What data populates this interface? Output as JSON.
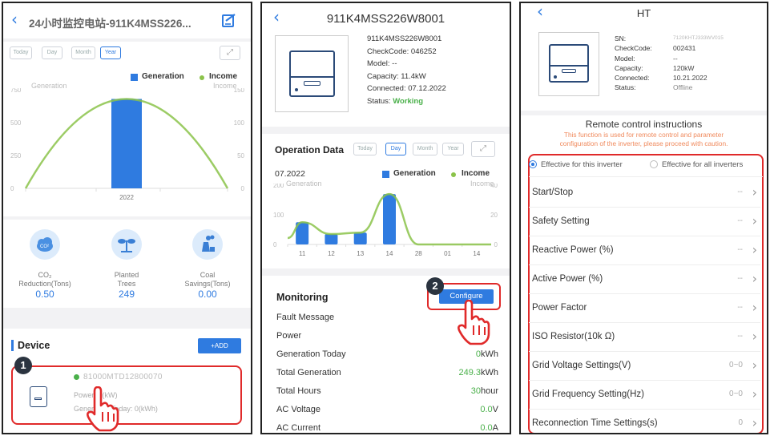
{
  "phone1": {
    "title": "24小时监控电站-911K4MSS226...",
    "tabs": [
      "Today",
      "Day",
      "Month",
      "Year"
    ],
    "legend_generation": "Generation",
    "legend_income": "Income",
    "axis_left_title": "Generation",
    "axis_right_title": "Income",
    "left_ticks": [
      "750",
      "500",
      "250",
      "0"
    ],
    "right_ticks": [
      "150",
      "100",
      "50",
      "0"
    ],
    "x_label": "2022",
    "stats": [
      {
        "label1": "CO₂",
        "label2": "Reduction(Tons)",
        "value": "0.50"
      },
      {
        "label1": "Planted",
        "label2": "Trees",
        "value": "249"
      },
      {
        "label1": "Coal",
        "label2": "Savings(Tons)",
        "value": "0.00"
      }
    ],
    "device_header": "Device",
    "add_label": "+ADD",
    "device_sn": "81000MTD12800070",
    "device_power": "Power: 0(kW)",
    "device_gen_today": "Generation Today: 0(kWh)",
    "badge": "1"
  },
  "phone2": {
    "title": "911K4MSS226W8001",
    "info": {
      "sn": "911K4MSS226W8001",
      "checkcode": "CheckCode: 046252",
      "model": "Model: --",
      "capacity": "Capacity: 11.4kW",
      "connected": "Connected: 07.12.2022",
      "status_label": "Status: ",
      "status_value": "Working"
    },
    "operation_title": "Operation Data",
    "tabs": [
      "Today",
      "Day",
      "Month",
      "Year"
    ],
    "date": "07.2022",
    "legend_generation": "Generation",
    "legend_income": "Income",
    "axis_left_title": "Generation",
    "axis_right_title": "Income",
    "left_ticks": [
      "200",
      "100",
      "0"
    ],
    "right_ticks": [
      "40",
      "20",
      "0"
    ],
    "x_ticks": [
      "11",
      "12",
      "13",
      "14",
      "28",
      "01",
      "14"
    ],
    "monitoring_title": "Monitoring",
    "configure_label": "Configure",
    "badge": "2",
    "rows": [
      {
        "label": "Fault Message",
        "value": "",
        "unit": ""
      },
      {
        "label": "Power",
        "value": "",
        "unit": ""
      },
      {
        "label": "Generation Today",
        "value": "0",
        "unit": "kWh"
      },
      {
        "label": "Total Generation",
        "value": "249.3",
        "unit": "kWh"
      },
      {
        "label": "Total Hours",
        "value": "30",
        "unit": "hour"
      },
      {
        "label": "AC Voltage",
        "value": "0.0",
        "unit": "V"
      },
      {
        "label": "AC Current",
        "value": "0.0",
        "unit": "A"
      }
    ]
  },
  "phone3": {
    "title": "HT",
    "info_labels": [
      "SN:",
      "CheckCode:",
      "Model:",
      "Capacity:",
      "Connected:",
      "Status:"
    ],
    "info_values": [
      "7120KHTJ333WV015",
      "002431",
      "--",
      "120kW",
      "10.21.2022",
      "Offline"
    ],
    "remote_title": "Remote control instructions",
    "warning_line1": "This function is used for remote control and parameter",
    "warning_line2": "configuration of the inverter, please proceed with caution.",
    "radio_this": "Effective for this inverter",
    "radio_all": "Effective for all inverters",
    "settings": [
      {
        "label": "Start/Stop",
        "value": "--"
      },
      {
        "label": "Safety Setting",
        "value": "--"
      },
      {
        "label": "Reactive Power (%)",
        "value": "--"
      },
      {
        "label": "Active Power (%)",
        "value": "--"
      },
      {
        "label": "Power Factor",
        "value": "--"
      },
      {
        "label": "ISO Resistor(10k Ω)",
        "value": "--"
      },
      {
        "label": "Grid Voltage Settings(V)",
        "value": "0~0"
      },
      {
        "label": "Grid Frequency Setting(Hz)",
        "value": "0~0"
      },
      {
        "label": "Reconnection Time Settings(s)",
        "value": "0"
      }
    ]
  },
  "colors": {
    "accent": "#2f7be0",
    "green": "#4ab04a",
    "highlight": "#e02a2a",
    "warning": "#f08a5d"
  },
  "chart_data": [
    {
      "type": "bar",
      "categories": [
        "2022"
      ],
      "series": [
        {
          "name": "Generation",
          "values": [
            680
          ]
        },
        {
          "name": "Income",
          "values": [
            136
          ]
        }
      ],
      "xlabel": "",
      "ylabel": "Generation",
      "ylim": [
        0,
        750
      ],
      "y2label": "Income",
      "y2lim": [
        0,
        150
      ],
      "legend": "top-right"
    },
    {
      "type": "bar",
      "categories": [
        "11",
        "12",
        "13",
        "14",
        "28",
        "01",
        "14"
      ],
      "series": [
        {
          "name": "Generation",
          "values": [
            75,
            35,
            40,
            170,
            0,
            0,
            0
          ]
        },
        {
          "name": "Income",
          "values": [
            15,
            7,
            8,
            34,
            0,
            0,
            0
          ]
        }
      ],
      "xlabel": "",
      "ylabel": "Generation",
      "ylim": [
        0,
        200
      ],
      "y2label": "Income",
      "y2lim": [
        0,
        40
      ],
      "legend": "top-right"
    }
  ]
}
